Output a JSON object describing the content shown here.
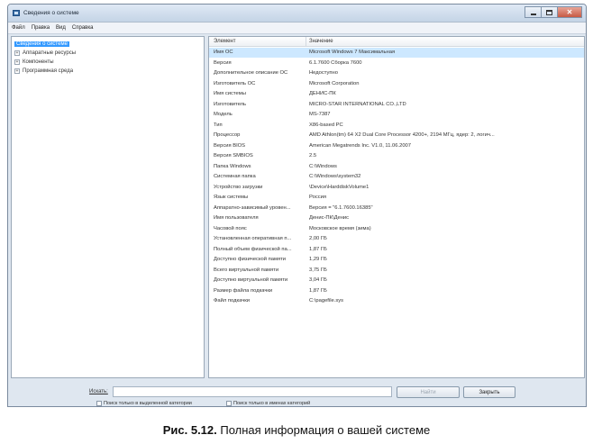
{
  "window": {
    "title": "Сведения о системе",
    "close_glyph": "✕"
  },
  "menu": [
    "Файл",
    "Правка",
    "Вид",
    "Справка"
  ],
  "tree": {
    "items": [
      {
        "label": "Сведения о системе",
        "selected": true
      },
      {
        "label": "Аппаратные ресурсы",
        "expander": "+"
      },
      {
        "label": "Компоненты",
        "expander": "+"
      },
      {
        "label": "Программная среда",
        "expander": "+"
      }
    ]
  },
  "table": {
    "headers": [
      "Элемент",
      "Значение"
    ],
    "rows": [
      [
        "Имя ОС",
        "Microsoft Windows 7 Максимальная"
      ],
      [
        "Версия",
        "6.1.7600 Сборка 7600"
      ],
      [
        "Дополнительное описание ОС",
        "Недоступно"
      ],
      [
        "Изготовитель ОС",
        "Microsoft Corporation"
      ],
      [
        "Имя системы",
        "ДЕНИС-ПК"
      ],
      [
        "Изготовитель",
        "MICRO-STAR INTERNATIONAL CO.,LTD"
      ],
      [
        "Модель",
        "MS-7387"
      ],
      [
        "Тип",
        "X86-based PC"
      ],
      [
        "Процессор",
        "AMD Athlon(tm) 64 X2 Dual Core Processor 4200+, 2194 МГц, ядер: 2, логич..."
      ],
      [
        "Версия BIOS",
        "American Megatrends Inc. V1.0, 11.06.2007"
      ],
      [
        "Версия SMBIOS",
        "2.5"
      ],
      [
        "Папка Windows",
        "C:\\Windows"
      ],
      [
        "Системная папка",
        "C:\\Windows\\system32"
      ],
      [
        "Устройство загрузки",
        "\\Device\\HarddiskVolume1"
      ],
      [
        "Язык системы",
        "Россия"
      ],
      [
        "Аппаратно-зависимый уровен...",
        "Версия = \"6.1.7600.16385\""
      ],
      [
        "Имя пользователя",
        "Денис-ПК\\Денис"
      ],
      [
        "Часовой пояс",
        "Московское время (зима)"
      ],
      [
        "Установленная оперативная п...",
        "2,00 ГБ"
      ],
      [
        "Полный объем физической па...",
        "1,87 ГБ"
      ],
      [
        "Доступно физической памяти",
        "1,29 ГБ"
      ],
      [
        "Всего виртуальной памяти",
        "3,75 ГБ"
      ],
      [
        "Доступно виртуальной памяти",
        "3,04 ГБ"
      ],
      [
        "Размер файла подкачки",
        "1,87 ГБ"
      ],
      [
        "Файл подкачки",
        "C:\\pagefile.sys"
      ]
    ]
  },
  "search": {
    "label": "Искать:",
    "value": "",
    "find_button": "Найти",
    "close_button": "Закрыть",
    "checkbox_selected_category": "Поиск только в выделенной категории",
    "checkbox_category_names": "Поиск только в именах категорий"
  },
  "caption": {
    "figure": "Рис. 5.12.",
    "text": " Полная информация о вашей системе"
  }
}
